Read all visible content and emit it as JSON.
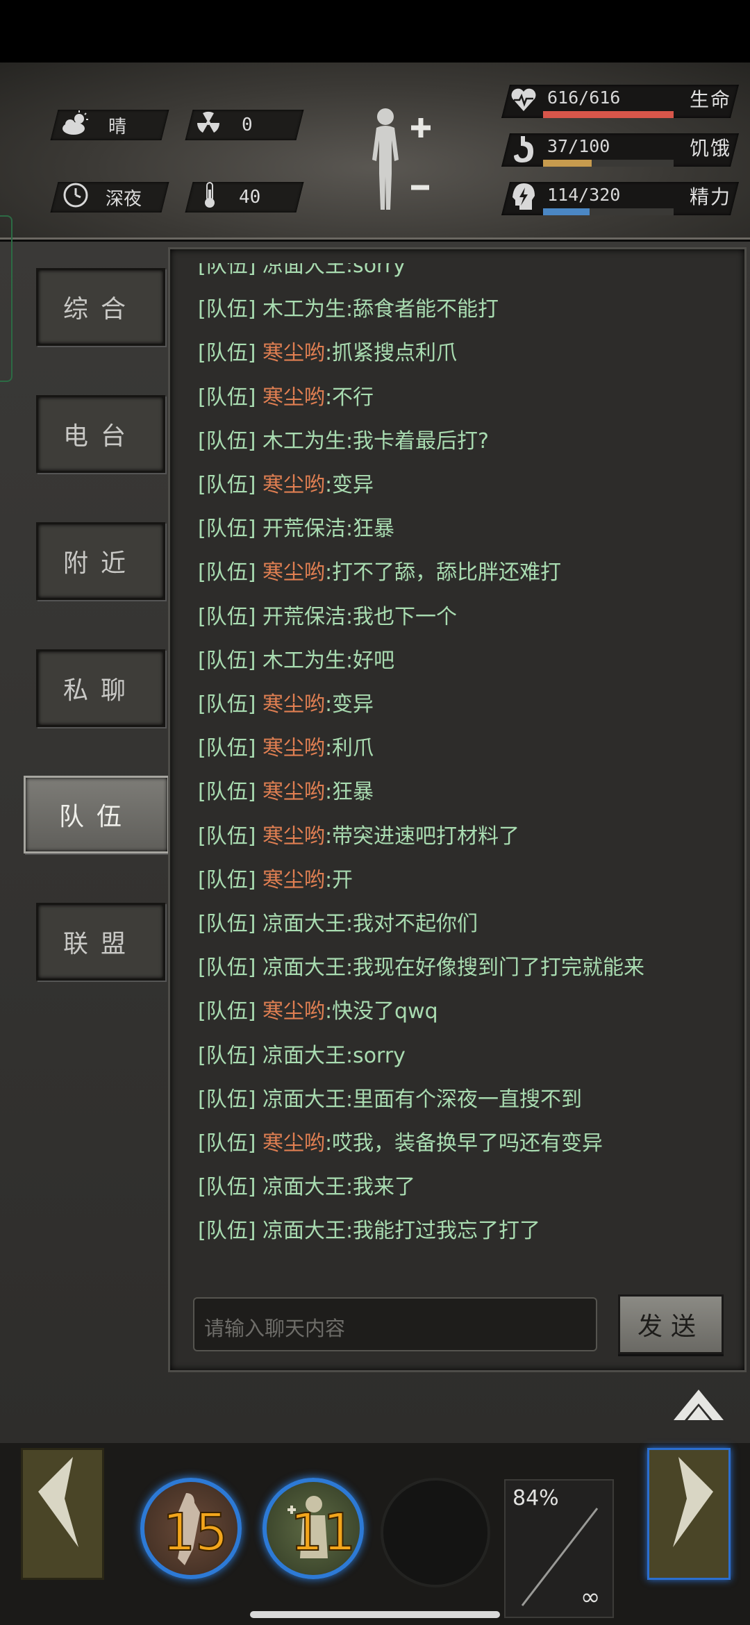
{
  "hud": {
    "weather_label": "晴",
    "radiation_value": "0",
    "time_label": "深夜",
    "temperature_value": "40",
    "stats": [
      {
        "value": "616/616",
        "name": "生命",
        "fraction": 1.0,
        "color": "#d8564a"
      },
      {
        "value": "37/100",
        "name": "饥饿",
        "fraction": 0.37,
        "color": "#c79b4e"
      },
      {
        "value": "114/320",
        "name": "精力",
        "fraction": 0.356,
        "color": "#4b87c4"
      }
    ]
  },
  "tabs": [
    {
      "label": "综合",
      "active": false
    },
    {
      "label": "电台",
      "active": false
    },
    {
      "label": "附近",
      "active": false
    },
    {
      "label": "私聊",
      "active": false
    },
    {
      "label": "队伍",
      "active": true
    },
    {
      "label": "联盟",
      "active": false
    }
  ],
  "chat": {
    "channel_tag": "[队伍]",
    "messages": [
      {
        "name": "凉面大王",
        "text": ":sorry",
        "orange": false
      },
      {
        "name": "木工为生",
        "text": ":舔食者能不能打",
        "orange": false
      },
      {
        "name": "寒尘哟",
        "text": ":抓紧搜点利爪",
        "orange": true
      },
      {
        "name": "寒尘哟",
        "text": ":不行",
        "orange": true
      },
      {
        "name": "木工为生",
        "text": ":我卡着最后打?",
        "orange": false
      },
      {
        "name": "寒尘哟",
        "text": ":变异",
        "orange": true
      },
      {
        "name": "开荒保洁",
        "text": ":狂暴",
        "orange": false
      },
      {
        "name": "寒尘哟",
        "text": ":打不了舔，舔比胖还难打",
        "orange": true
      },
      {
        "name": "开荒保洁",
        "text": ":我也下一个",
        "orange": false
      },
      {
        "name": "木工为生",
        "text": ":好吧",
        "orange": false
      },
      {
        "name": "寒尘哟",
        "text": ":变异",
        "orange": true
      },
      {
        "name": "寒尘哟",
        "text": ":利爪",
        "orange": true
      },
      {
        "name": "寒尘哟",
        "text": ":狂暴",
        "orange": true
      },
      {
        "name": "寒尘哟",
        "text": ":带突进速吧打材料了",
        "orange": true
      },
      {
        "name": "寒尘哟",
        "text": ":开",
        "orange": true
      },
      {
        "name": "凉面大王",
        "text": ":我对不起你们",
        "orange": false
      },
      {
        "name": "凉面大王",
        "text": ":我现在好像搜到门了打完就能来",
        "orange": false
      },
      {
        "name": "寒尘哟",
        "text": ":快没了qwq",
        "orange": true
      },
      {
        "name": "凉面大王",
        "text": ":sorry",
        "orange": false
      },
      {
        "name": "凉面大王",
        "text": ":里面有个深夜一直搜不到",
        "orange": false
      },
      {
        "name": "寒尘哟",
        "text": ":哎我，装备换早了吗还有变异",
        "orange": true
      },
      {
        "name": "凉面大王",
        "text": ":我来了",
        "orange": false
      },
      {
        "name": "凉面大王",
        "text": ":我能打过我忘了打了",
        "orange": false
      }
    ],
    "input_placeholder": "请输入聊天内容",
    "send_label": "发送"
  },
  "actionbar": {
    "skill1_count": "15",
    "skill2_count": "11",
    "durability_pct": "84%",
    "durability_symbol": "∞"
  }
}
